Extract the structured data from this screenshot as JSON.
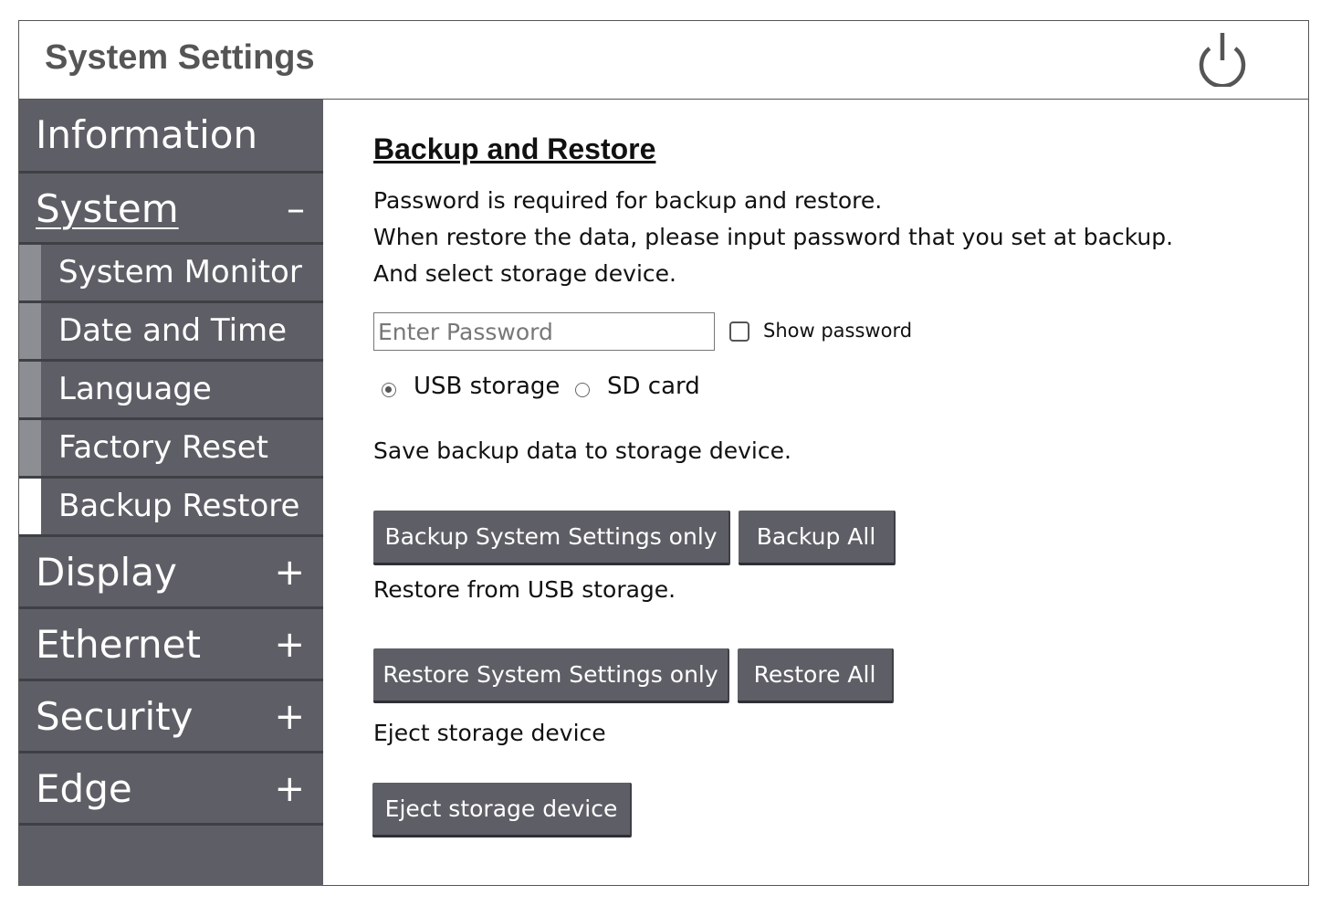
{
  "header": {
    "title": "System Settings",
    "power_icon": "power-icon"
  },
  "sidebar": {
    "items": [
      {
        "label": "Information",
        "sign": ""
      },
      {
        "label": "System",
        "sign": "–"
      },
      {
        "label": "Display",
        "sign": "+"
      },
      {
        "label": "Ethernet",
        "sign": "+"
      },
      {
        "label": "Security",
        "sign": "+"
      },
      {
        "label": "Edge",
        "sign": "+"
      }
    ],
    "sub_items": [
      {
        "label": "System Monitor"
      },
      {
        "label": "Date and Time"
      },
      {
        "label": "Language"
      },
      {
        "label": "Factory Reset"
      },
      {
        "label": "Backup Restore",
        "active": true
      }
    ]
  },
  "content": {
    "title": "Backup and Restore",
    "intro": [
      "Password is required for backup and restore.",
      "When restore the data, please input password that you set at backup.",
      "And select storage device."
    ],
    "password": {
      "placeholder": "Enter Password",
      "value": ""
    },
    "show_password_label": "Show password",
    "storage_options": [
      {
        "label": "USB storage",
        "selected": true
      },
      {
        "label": "SD card",
        "selected": false
      }
    ],
    "backup": {
      "text": "Save backup data to storage device.",
      "buttons": [
        "Backup System Settings only",
        "Backup All"
      ]
    },
    "restore": {
      "text": "Restore from USB storage.",
      "buttons": [
        "Restore System Settings only",
        "Restore All"
      ]
    },
    "eject": {
      "text": "Eject storage device",
      "button": "Eject storage device"
    }
  },
  "colors": {
    "sidebar": "#5e5f66",
    "sub_bar": "#8d8e94",
    "active_bar": "#ffffff",
    "header_text": "#555555"
  }
}
